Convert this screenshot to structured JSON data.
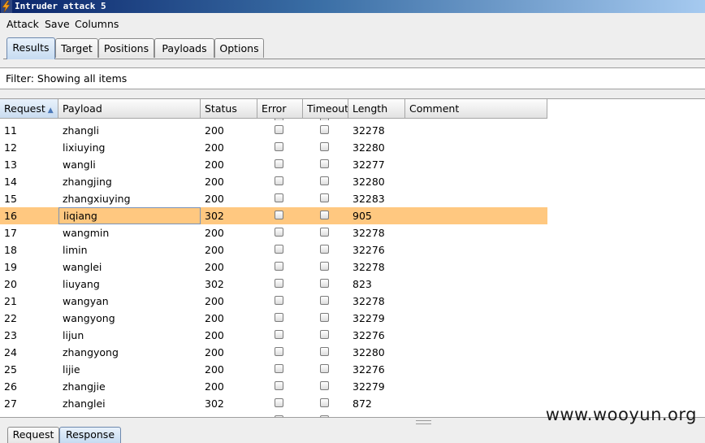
{
  "window": {
    "title": "Intruder attack 5"
  },
  "menu": [
    "Attack",
    "Save",
    "Columns"
  ],
  "tabs": [
    "Results",
    "Target",
    "Positions",
    "Payloads",
    "Options"
  ],
  "active_tab": "Results",
  "filter": {
    "text": "Filter: Showing all items"
  },
  "table": {
    "columns": [
      "Request",
      "Payload",
      "Status",
      "Error",
      "Timeout",
      "Length",
      "Comment"
    ],
    "sorted_column": "Request",
    "sort_direction": "ascending",
    "rows": [
      {
        "request": "11",
        "payload": "zhangli",
        "status": "200",
        "length": "32278",
        "comment": ""
      },
      {
        "request": "12",
        "payload": "lixiuying",
        "status": "200",
        "length": "32280",
        "comment": ""
      },
      {
        "request": "13",
        "payload": "wangli",
        "status": "200",
        "length": "32277",
        "comment": ""
      },
      {
        "request": "14",
        "payload": "zhangjing",
        "status": "200",
        "length": "32280",
        "comment": ""
      },
      {
        "request": "15",
        "payload": "zhangxiuying",
        "status": "200",
        "length": "32283",
        "comment": ""
      },
      {
        "request": "16",
        "payload": "liqiang",
        "status": "302",
        "length": "905",
        "comment": "",
        "selected": true
      },
      {
        "request": "17",
        "payload": "wangmin",
        "status": "200",
        "length": "32278",
        "comment": ""
      },
      {
        "request": "18",
        "payload": "limin",
        "status": "200",
        "length": "32276",
        "comment": ""
      },
      {
        "request": "19",
        "payload": "wanglei",
        "status": "200",
        "length": "32278",
        "comment": ""
      },
      {
        "request": "20",
        "payload": "liuyang",
        "status": "302",
        "length": "823",
        "comment": ""
      },
      {
        "request": "21",
        "payload": "wangyan",
        "status": "200",
        "length": "32278",
        "comment": ""
      },
      {
        "request": "22",
        "payload": "wangyong",
        "status": "200",
        "length": "32279",
        "comment": ""
      },
      {
        "request": "23",
        "payload": "lijun",
        "status": "200",
        "length": "32276",
        "comment": ""
      },
      {
        "request": "24",
        "payload": "zhangyong",
        "status": "200",
        "length": "32280",
        "comment": ""
      },
      {
        "request": "25",
        "payload": "lijie",
        "status": "200",
        "length": "32276",
        "comment": ""
      },
      {
        "request": "26",
        "payload": "zhangjie",
        "status": "200",
        "length": "32279",
        "comment": ""
      },
      {
        "request": "27",
        "payload": "zhanglei",
        "status": "302",
        "length": "872",
        "comment": ""
      }
    ]
  },
  "bottom_tabs": [
    "Request",
    "Response"
  ],
  "active_bottom_tab": "Response",
  "watermark": "www.wooyun.org",
  "colors": {
    "selected_row": "#ffc880",
    "title_bar": "#0a246a"
  },
  "icons": {
    "app": "lightning-icon"
  }
}
